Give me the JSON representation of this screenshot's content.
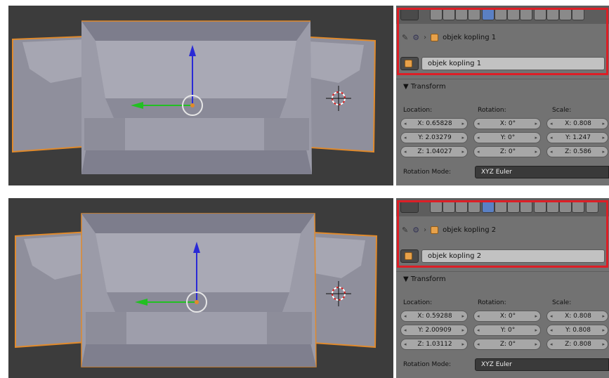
{
  "panels": [
    {
      "breadcrumb_object": "objek kopling 1",
      "object_name": "objek kopling 1",
      "transform_label": "▼ Transform",
      "location_label": "Location:",
      "rotation_label": "Rotation:",
      "scale_label": "Scale:",
      "location": [
        "X: 0.65828",
        "Y: 2.03279",
        "Z: 1.04027"
      ],
      "rotation": [
        "X: 0°",
        "Y: 0°",
        "Z: 0°"
      ],
      "scale": [
        "X: 0.808",
        "Y: 1.247",
        "Z: 0.586"
      ],
      "rotation_mode_label": "Rotation Mode:",
      "rotation_mode_value": "XYZ Euler"
    },
    {
      "breadcrumb_object": "objek kopling 2",
      "object_name": "objek kopling 2",
      "transform_label": "▼ Transform",
      "location_label": "Location:",
      "rotation_label": "Rotation:",
      "scale_label": "Scale:",
      "location": [
        "X: 0.59288",
        "Y: 2.00909",
        "Z: 1.03112"
      ],
      "rotation": [
        "X: 0°",
        "Y: 0°",
        "Z: 0°"
      ],
      "scale": [
        "X: 0.808",
        "Y: 0.808",
        "Z: 0.808"
      ],
      "rotation_mode_label": "Rotation Mode:",
      "rotation_mode_value": "XYZ Euler"
    }
  ],
  "colors": {
    "highlight": "#dd1e26",
    "mesh_face": "#9b9ba8",
    "selection_outline": "#e08a2c",
    "axis_z": "#2a2ad6",
    "axis_y": "#22c022",
    "viewport_bg": "#3c3c3c"
  },
  "icons": [
    "editor-type-icon",
    "render-icon",
    "layers-icon",
    "scene-icon",
    "world-icon",
    "object-icon",
    "constraints-icon",
    "modifiers-icon",
    "data-icon",
    "material-icon",
    "texture-icon",
    "particles-icon",
    "physics-icon",
    "pin-icon",
    "scene-tree-icon",
    "cube-icon",
    "3d-cursor-icon"
  ]
}
